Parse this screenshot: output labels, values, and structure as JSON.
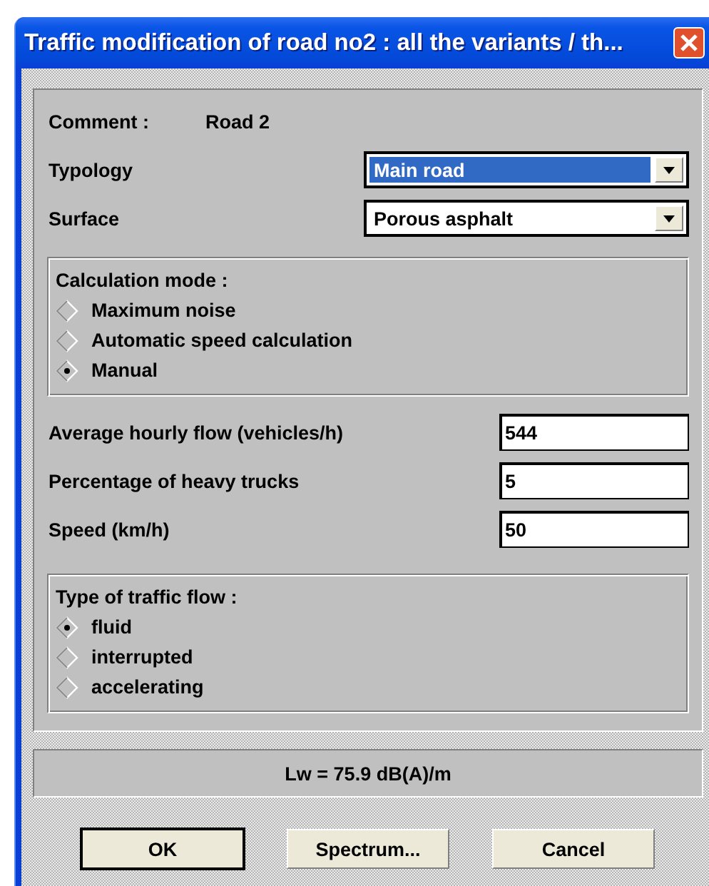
{
  "window": {
    "title": "Traffic modification of road no2 : all the variants / th..."
  },
  "comment": {
    "label": "Comment :",
    "value": "Road 2"
  },
  "selects": [
    {
      "label": "Typology",
      "value": "Main road",
      "highlighted": true
    },
    {
      "label": "Surface",
      "value": "Porous asphalt",
      "highlighted": false
    }
  ],
  "calculation_mode": {
    "title": "Calculation mode :",
    "options": [
      {
        "label": "Maximum noise",
        "selected": false
      },
      {
        "label": "Automatic speed calculation",
        "selected": false
      },
      {
        "label": "Manual",
        "selected": true
      }
    ]
  },
  "fields": [
    {
      "label": "Average hourly flow (vehicles/h)",
      "value": "544"
    },
    {
      "label": "Percentage of heavy trucks",
      "value": "5"
    },
    {
      "label": "Speed (km/h)",
      "value": "50"
    }
  ],
  "traffic_flow": {
    "title": "Type of traffic flow :",
    "options": [
      {
        "label": "fluid",
        "selected": true
      },
      {
        "label": "interrupted",
        "selected": false
      },
      {
        "label": "accelerating",
        "selected": false
      }
    ]
  },
  "result": "Lw = 75.9 dB(A)/m",
  "buttons": [
    {
      "label": "OK",
      "default": true
    },
    {
      "label": "Spectrum...",
      "default": false
    },
    {
      "label": "Cancel",
      "default": false
    }
  ]
}
